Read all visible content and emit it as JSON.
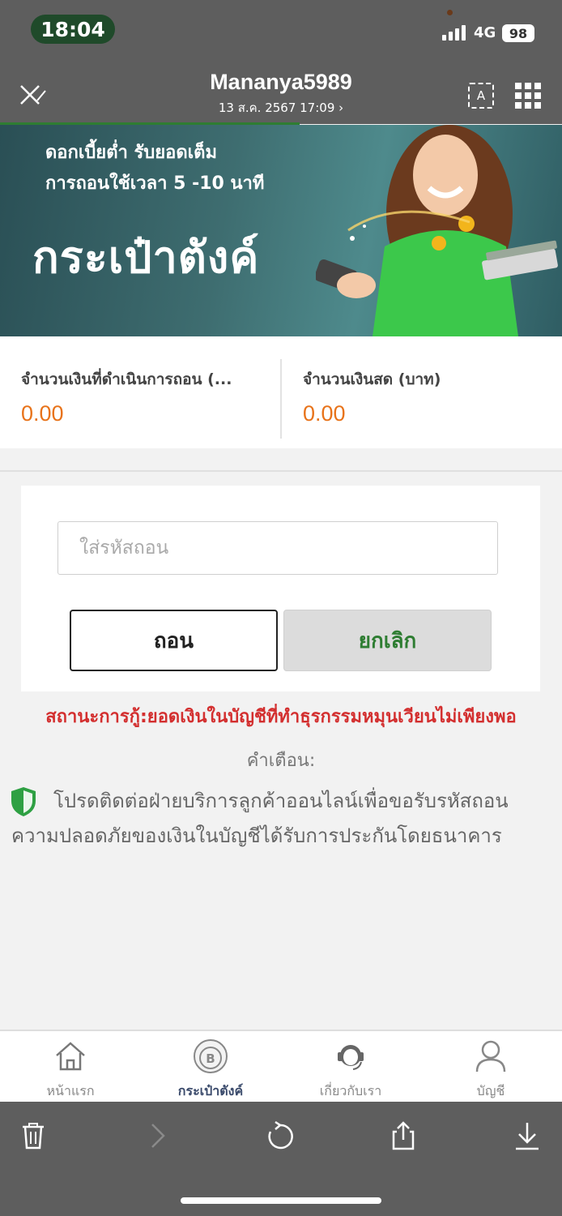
{
  "status_bar": {
    "time": "18:04",
    "network": "4G",
    "battery": "98"
  },
  "header": {
    "title": "Mananya5989",
    "subtitle": "13 ส.ค. 2567 17:09 ›",
    "translate_label": "A"
  },
  "banner": {
    "line1": "ดอกเบี้ยต่ำ รับยอดเต็ม",
    "line2": "การถอนใช้เวลา 5 -10 นาที",
    "title": "กระเป๋าตังค์"
  },
  "balance": {
    "withdraw_label": "จำนวนเงินที่ดำเนินการถอน (...",
    "withdraw_value": "0.00",
    "cash_label": "จำนวนเงินสด (บาท)",
    "cash_value": "0.00"
  },
  "form": {
    "password_placeholder": "ใส่รหัสถอน",
    "withdraw_button": "ถอน",
    "cancel_button": "ยกเลิก"
  },
  "messages": {
    "status": "สถานะการกู้:ยอดเงินในบัญชีที่ทำธุรกรรมหมุนเวียนไม่เพียงพอ",
    "warning_title": "คำเตือน:",
    "notice_line1": "โปรดติดต่อฝ่ายบริการลูกค้าออนไลน์เพื่อขอรับรหัสถอน",
    "notice_line2": "ความปลอดภัยของเงินในบัญชีได้รับการประกันโดยธนาคาร"
  },
  "bottom_nav": [
    {
      "label": "หน้าแรก",
      "icon": "home-icon",
      "active": false
    },
    {
      "label": "กระเป๋าตังค์",
      "icon": "wallet-coin-icon",
      "active": true
    },
    {
      "label": "เกี่ยวกับเรา",
      "icon": "support-agent-icon",
      "active": false
    },
    {
      "label": "บัญชี",
      "icon": "user-icon",
      "active": false
    }
  ],
  "browser_toolbar": [
    "trash-icon",
    "forward-icon",
    "refresh-icon",
    "share-icon",
    "download-icon"
  ],
  "colors": {
    "header_bg": "#5e5e5e",
    "accent_orange": "#e8731a",
    "accent_green": "#2e7d32",
    "status_red": "#d32f2f"
  }
}
